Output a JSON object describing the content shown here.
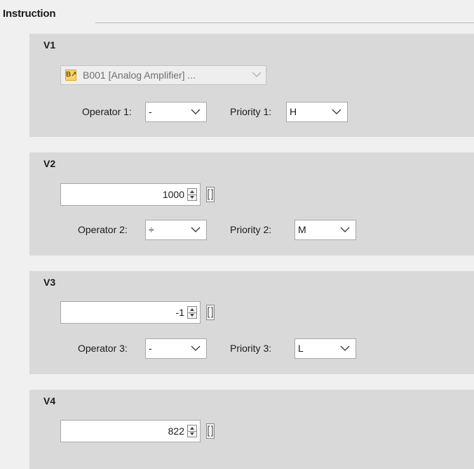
{
  "group": {
    "title": "Instruction"
  },
  "panels": [
    {
      "title": "V1",
      "block": {
        "text": "B001 [Analog Amplifier] ...",
        "icon": "analog-amplifier-block-icon",
        "icon_glyph": "B↗"
      },
      "operator": {
        "label": "Operator 1:",
        "value": "-"
      },
      "priority": {
        "label": "Priority 1:",
        "value": "H"
      }
    },
    {
      "title": "V2",
      "value": "1000",
      "operator": {
        "label": "Operator 2:",
        "value": "÷"
      },
      "priority": {
        "label": "Priority 2:",
        "value": "M"
      }
    },
    {
      "title": "V3",
      "value": "-1",
      "operator": {
        "label": "Operator 3:",
        "value": "-"
      },
      "priority": {
        "label": "Priority 3:",
        "value": "L"
      }
    },
    {
      "title": "V4",
      "value": "822"
    }
  ],
  "icons": {
    "dropdown": "chevron-down-icon",
    "spinner": "spinner-arrows-icon",
    "bracket": "bracket-icon"
  },
  "colors": {
    "page_background": "#f0f0f0",
    "panel_background": "#d9d9d9",
    "block_icon": "#f7d36a"
  }
}
